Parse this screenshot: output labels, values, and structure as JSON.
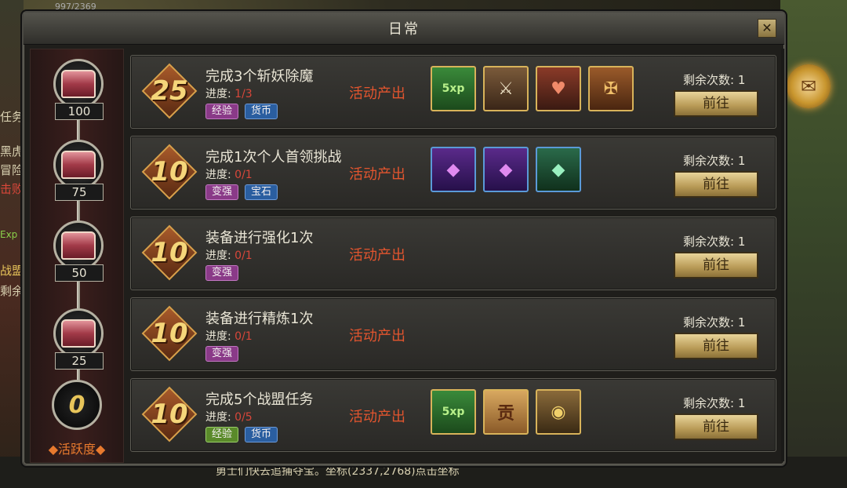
{
  "window": {
    "title": "日常",
    "close_label": "✕"
  },
  "background": {
    "top_text": "997/2369",
    "left_texts": [
      "任务",
      "黑虎",
      "冒险",
      "击败",
      "Exp",
      "战盟",
      "剩余"
    ],
    "bottom_text": "勇士们快去追捕夺宝。坐标(2337,2768)点击坐标"
  },
  "sidebar": {
    "chests": [
      {
        "points": "100"
      },
      {
        "points": "75"
      },
      {
        "points": "50"
      },
      {
        "points": "25"
      }
    ],
    "current_points": "0",
    "label": "◆活跃度◆"
  },
  "tasks": [
    {
      "score": "25",
      "name": "完成3个斩妖除魔",
      "progress_label": "进度:",
      "progress_value": "1/3",
      "tags": [
        "经验",
        "货币"
      ],
      "source": "活动产出",
      "rewards": [
        "xp-icon",
        "sword-emblem-icon",
        "heart-emblem-icon",
        "crest-icon"
      ],
      "remain_label": "剩余次数: 1",
      "button": "前往"
    },
    {
      "score": "10",
      "name": "完成1次个人首领挑战",
      "progress_label": "进度:",
      "progress_value": "0/1",
      "tags": [
        "变强",
        "宝石"
      ],
      "source": "活动产出",
      "rewards": [
        "purple-gem-icon",
        "purple-gem-icon",
        "green-gem-icon"
      ],
      "remain_label": "剩余次数: 1",
      "button": "前往"
    },
    {
      "score": "10",
      "name": "装备进行强化1次",
      "progress_label": "进度:",
      "progress_value": "0/1",
      "tags": [
        "变强"
      ],
      "source": "活动产出",
      "rewards": [],
      "remain_label": "剩余次数: 1",
      "button": "前往"
    },
    {
      "score": "10",
      "name": "装备进行精炼1次",
      "progress_label": "进度:",
      "progress_value": "0/1",
      "tags": [
        "变强"
      ],
      "source": "活动产出",
      "rewards": [],
      "remain_label": "剩余次数: 1",
      "button": "前往"
    },
    {
      "score": "10",
      "name": "完成5个战盟任务",
      "progress_label": "进度:",
      "progress_value": "0/5",
      "tags": [
        "经验",
        "货币"
      ],
      "source": "活动产出",
      "rewards": [
        "xp-icon",
        "contribution-note-icon",
        "coins-icon"
      ],
      "remain_label": "剩余次数: 1",
      "button": "前往"
    }
  ],
  "reward_glyphs": {
    "xp": "5xp",
    "note": "贡"
  },
  "colors": {
    "accent_red": "#e2552e",
    "progress_red": "#d8473a",
    "gold": "#f5d67a"
  }
}
